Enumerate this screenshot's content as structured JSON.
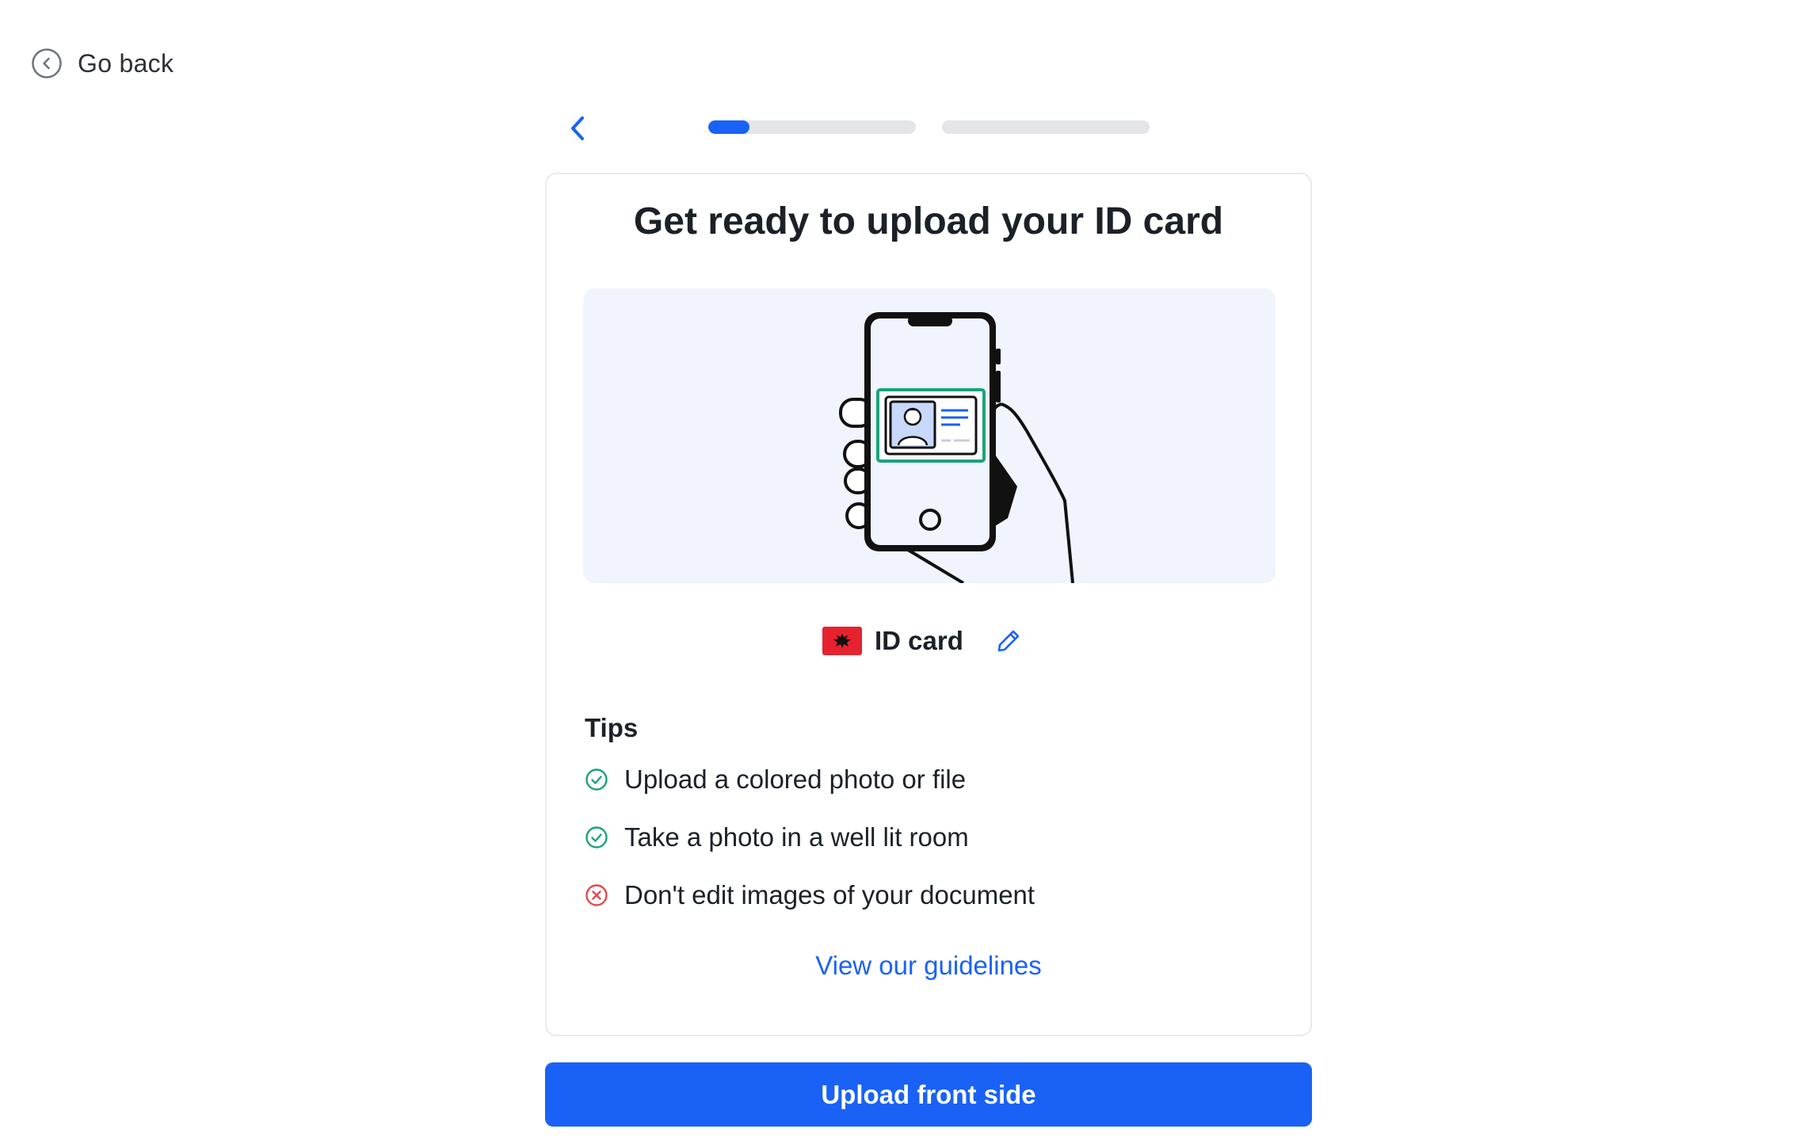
{
  "nav": {
    "go_back_label": "Go back"
  },
  "progress": {
    "steps": [
      {
        "fill_fraction": 0.2
      },
      {
        "fill_fraction": 0
      }
    ]
  },
  "card": {
    "title": "Get ready to upload your ID card",
    "document": {
      "label": "ID card",
      "flag_color": "#e4232f",
      "flag_icon": "albania-flag-icon",
      "edit_icon": "pencil-icon"
    },
    "tips": {
      "heading": "Tips",
      "items": [
        {
          "text": "Upload a colored photo or file",
          "status": "do",
          "icon": "check-circle-icon"
        },
        {
          "text": "Take a photo in a well lit room",
          "status": "do",
          "icon": "check-circle-icon"
        },
        {
          "text": "Don't edit images of your document",
          "status": "dont",
          "icon": "x-circle-icon"
        }
      ]
    },
    "guidelines_link": "View our guidelines"
  },
  "primary_action": {
    "label": "Upload front side"
  },
  "colors": {
    "accent": "#1a62f5",
    "success": "#1aa37a",
    "error": "#e5484d",
    "illustration_bg": "#f1f4fd"
  }
}
